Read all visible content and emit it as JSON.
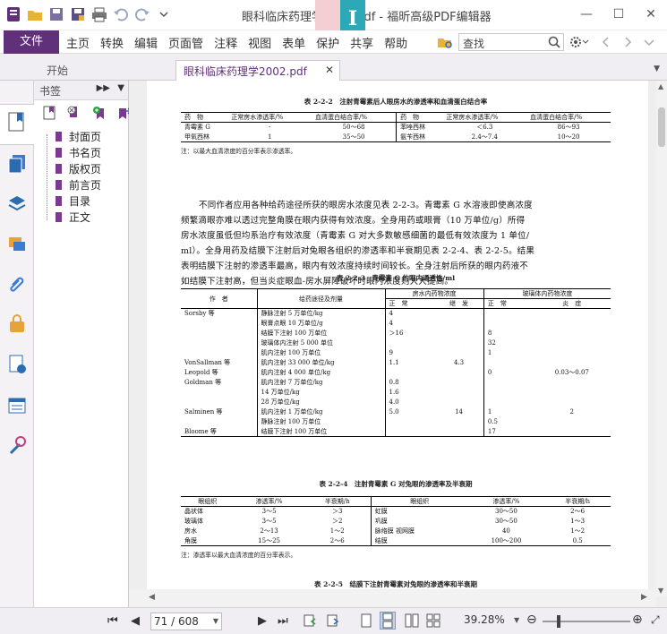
{
  "window": {
    "title": "眼科临床药理学2002.pdf - 福昕高级PDF编辑器",
    "logo_letter": "I"
  },
  "menu": {
    "file": "文件",
    "items": [
      "主页",
      "转换",
      "编辑",
      "页面管",
      "注释",
      "视图",
      "表单",
      "保护",
      "共享",
      "帮助"
    ],
    "search_placeholder": "查找"
  },
  "tabs": {
    "start": "开始",
    "doc": "眼科临床药理学2002.pdf"
  },
  "bookmarks": {
    "title": "书签",
    "items": [
      "封面页",
      "书名页",
      "版权页",
      "前言页",
      "目录",
      "正文"
    ]
  },
  "status": {
    "page_display": "71 / 608",
    "zoom": "39.28%"
  },
  "content": {
    "t222_caption": "表 2-2-2　注射青霉素后人眼房水的渗透率和血清蛋白结合率",
    "t222_header": [
      "药　物",
      "正常房水渗透率/%",
      "血清蛋白结合率/%",
      "药　物",
      "正常房水渗透率/%",
      "血清蛋白结合率/%"
    ],
    "t222_rows": [
      [
        "青霉素 G",
        "-",
        "50～68",
        "苯唑西林",
        "＜6.3",
        "86～93"
      ],
      [
        "甲氧西林",
        "1",
        "35～50",
        "氨苄西林",
        "2.4～7.4",
        "10～20"
      ]
    ],
    "t222_note": "注：以最大血清浓度的百分率表示渗透率。",
    "paragraph1": [
      "不同作者应用各种给药途径所获的眼房水浓度见表 2-2-3。青霉素 G 水溶液即使高浓度",
      "频繁滴眼亦难以透过完整角膜在眼内获得有效浓度。全身用药或眼膏（10 万单位/g）所得",
      "房水浓度虽低但均系治疗有效浓度（青霉素 G 对大多数敏感细菌的最低有效浓度为 1 单位/",
      "ml）。全身用药及结膜下注射后对兔眼各组织的渗透率和半衰期见表 2-2-4、表 2-2-5。结果",
      "表明结膜下注射的渗透率最高，眼内有效浓度持续时间较长。全身注射后所获的眼内药液不",
      "如结膜下注射高，但当炎症眼血-房水屏障破坏时眼内浓度则大大提高。"
    ],
    "t223_caption": "表 2-2-3　青霉素 G 的眼内通透性/ml",
    "t223_header": {
      "author": "作　者",
      "route": "给药途径及剂量",
      "aqueous": "房水内药物浓度",
      "vitreous": "玻璃体内药物浓度",
      "normal": "正　常",
      "inflamed": "继　发",
      "normal2": "正　常",
      "inflamed2": "炎　症"
    },
    "t223_rows": [
      [
        "Sorsby 等",
        "静脉注射 5 万单位/kg",
        "4",
        "",
        "",
        ""
      ],
      [
        "",
        "眼膏点眼 10 万单位/g",
        "4",
        "",
        "",
        ""
      ],
      [
        "",
        "结膜下注射 100 万单位",
        "＞16",
        "",
        "8",
        ""
      ],
      [
        "",
        "玻璃体内注射 5 000 单位",
        "",
        "",
        "32",
        ""
      ],
      [
        "",
        "肌内注射 100 万单位",
        "9",
        "",
        "1",
        ""
      ],
      [
        "VonSallman 等",
        "肌内注射 33 000 单位/kg",
        "1.1",
        "4.3",
        "",
        ""
      ],
      [
        "Leopold 等",
        "肌内注射 4 000 单位/kg",
        "",
        "",
        "0",
        "0.03～0.07"
      ],
      [
        "Goldman 等",
        "肌内注射 7 万单位/kg",
        "0.8",
        "",
        "",
        ""
      ],
      [
        "",
        "14 万单位/kg",
        "1.6",
        "",
        "",
        ""
      ],
      [
        "",
        "28 万单位/kg",
        "4.0",
        "",
        "",
        ""
      ],
      [
        "Salminen 等",
        "肌内注射 1 万单位/kg",
        "5.0",
        "14",
        "1",
        "2"
      ],
      [
        "",
        "静脉注射 100 万单位",
        "",
        "",
        "0.5",
        ""
      ],
      [
        "Bloome 等",
        "结膜下注射 100 万单位",
        "",
        "",
        "17",
        ""
      ]
    ],
    "t224_caption": "表 2-2-4　注射青霉素 G 对兔眼的渗透率及半衰期",
    "t224_header": [
      "眼组织",
      "渗透率/%",
      "半衰期/h",
      "眼组织",
      "渗透率/%",
      "半衰期/h"
    ],
    "t224_rows": [
      [
        "晶状体",
        "3～5",
        "＞3",
        "虹膜",
        "30～50",
        "2～6"
      ],
      [
        "玻璃体",
        "3～5",
        "＞2",
        "巩膜",
        "30～50",
        "1～3"
      ],
      [
        "房水",
        "2～13",
        "1～2",
        "脉络膜 视网膜",
        "40",
        "1～2"
      ],
      [
        "角膜",
        "15～25",
        "2～6",
        "结膜",
        "100～200",
        "0.5"
      ]
    ],
    "t224_note": "注：渗透率以最大血清浓度的百分率表示。",
    "t225_caption": "表 2-2-5　结膜下注射青霉素对兔眼的渗透率和半衰期"
  }
}
